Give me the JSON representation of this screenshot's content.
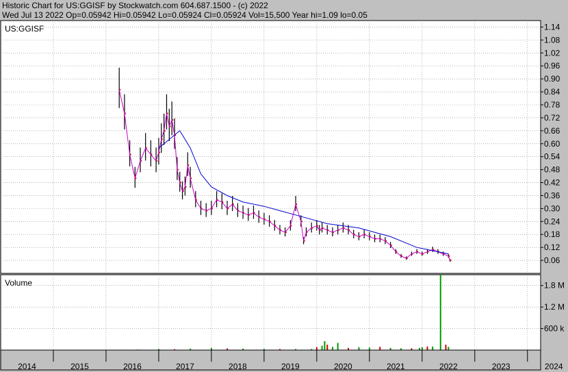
{
  "header": {
    "title_line": "Historic Chart for US:GGISF by Stockwatch.com 604.687.1500 - (c) 2022",
    "quote_line": "Wed Jul 13 2022  Op=0.05942  Hi=0.05942  Lo=0.05924  Cl=0.05924  Vol=15,500  Year hi=1.09  lo=0.05"
  },
  "chart_data": {
    "type": "candlestick",
    "symbol": "US:GGISF",
    "volume_label": "Volume",
    "x_ticks": [
      "2014",
      "2015",
      "2016",
      "2017",
      "2018",
      "2019",
      "2020",
      "2021",
      "2022",
      "2023",
      "2024"
    ],
    "price_ticks": [
      "1.14",
      "1.08",
      "1.02",
      "0.96",
      "0.90",
      "0.84",
      "0.78",
      "0.72",
      "0.66",
      "0.60",
      "0.54",
      "0.48",
      "0.42",
      "0.36",
      "0.30",
      "0.24",
      "0.18",
      "0.12",
      "0.06"
    ],
    "price_tick_values": [
      1.14,
      1.08,
      1.02,
      0.96,
      0.9,
      0.84,
      0.78,
      0.72,
      0.66,
      0.6,
      0.54,
      0.48,
      0.42,
      0.36,
      0.3,
      0.24,
      0.18,
      0.12,
      0.06
    ],
    "volume_ticks": [
      "1.8 M",
      "1.2 M",
      "600 k"
    ],
    "volume_tick_values": [
      1800000,
      1200000,
      600000
    ],
    "ylim_price": [
      0.0,
      1.17
    ],
    "ylim_volume": [
      0,
      2100000
    ],
    "xlim": [
      2014.0,
      2024.25
    ],
    "colors": {
      "bar": "#000000",
      "close_mark": "#cc0000",
      "ma_short": "#cc00cc",
      "ma_long": "#0000cc",
      "vol_up": "#009900",
      "vol_down": "#cc0000",
      "grid": "#808080"
    },
    "price_series": {
      "x": [
        2016.25,
        2016.35,
        2016.45,
        2016.55,
        2016.65,
        2016.75,
        2016.85,
        2016.95,
        2017.0,
        2017.05,
        2017.1,
        2017.15,
        2017.2,
        2017.25,
        2017.3,
        2017.35,
        2017.4,
        2017.45,
        2017.5,
        2017.55,
        2017.6,
        2017.7,
        2017.8,
        2017.9,
        2018.0,
        2018.1,
        2018.2,
        2018.3,
        2018.4,
        2018.5,
        2018.6,
        2018.7,
        2018.8,
        2018.9,
        2019.0,
        2019.1,
        2019.2,
        2019.3,
        2019.4,
        2019.5,
        2019.6,
        2019.7,
        2019.75,
        2019.8,
        2019.9,
        2020.0,
        2020.05,
        2020.1,
        2020.2,
        2020.3,
        2020.4,
        2020.5,
        2020.6,
        2020.7,
        2020.8,
        2020.9,
        2021.0,
        2021.1,
        2021.2,
        2021.3,
        2021.4,
        2021.5,
        2021.6,
        2021.7,
        2021.8,
        2021.9,
        2022.0,
        2022.1,
        2022.2,
        2022.3,
        2022.4,
        2022.5,
        2022.53
      ],
      "close": [
        0.85,
        0.74,
        0.55,
        0.44,
        0.52,
        0.58,
        0.55,
        0.52,
        0.56,
        0.62,
        0.66,
        0.74,
        0.68,
        0.71,
        0.64,
        0.48,
        0.42,
        0.38,
        0.4,
        0.5,
        0.44,
        0.34,
        0.3,
        0.29,
        0.3,
        0.34,
        0.33,
        0.3,
        0.32,
        0.29,
        0.28,
        0.27,
        0.28,
        0.26,
        0.25,
        0.24,
        0.22,
        0.2,
        0.19,
        0.22,
        0.32,
        0.24,
        0.15,
        0.19,
        0.21,
        0.22,
        0.2,
        0.21,
        0.2,
        0.19,
        0.2,
        0.21,
        0.2,
        0.18,
        0.17,
        0.18,
        0.17,
        0.16,
        0.16,
        0.15,
        0.13,
        0.1,
        0.08,
        0.07,
        0.09,
        0.1,
        0.09,
        0.1,
        0.11,
        0.1,
        0.09,
        0.08,
        0.06
      ]
    },
    "ma_long": {
      "x": [
        2017.0,
        2017.2,
        2017.4,
        2017.6,
        2017.8,
        2018.0,
        2018.3,
        2018.6,
        2019.0,
        2019.3,
        2019.6,
        2019.9,
        2020.2,
        2020.5,
        2020.8,
        2021.1,
        2021.4,
        2021.7,
        2021.9,
        2022.1,
        2022.3,
        2022.5
      ],
      "y": [
        0.58,
        0.62,
        0.66,
        0.58,
        0.46,
        0.4,
        0.36,
        0.33,
        0.31,
        0.29,
        0.27,
        0.25,
        0.23,
        0.22,
        0.21,
        0.19,
        0.17,
        0.14,
        0.12,
        0.11,
        0.1,
        0.09
      ]
    },
    "volume_series": {
      "x": [
        2016.3,
        2016.6,
        2017.0,
        2017.3,
        2017.6,
        2018.0,
        2018.3,
        2018.6,
        2019.0,
        2019.3,
        2019.6,
        2019.9,
        2020.0,
        2020.1,
        2020.15,
        2020.2,
        2020.3,
        2020.4,
        2020.6,
        2020.8,
        2021.0,
        2021.2,
        2021.4,
        2021.6,
        2021.8,
        2021.95,
        2022.0,
        2022.1,
        2022.2,
        2022.35,
        2022.45,
        2022.5
      ],
      "values": [
        10000,
        15000,
        30000,
        25000,
        40000,
        60000,
        45000,
        40000,
        35000,
        30000,
        30000,
        30000,
        80000,
        120000,
        250000,
        150000,
        90000,
        200000,
        60000,
        80000,
        70000,
        90000,
        60000,
        50000,
        50000,
        60000,
        80000,
        100000,
        100000,
        2100000,
        150000,
        90000
      ]
    }
  }
}
